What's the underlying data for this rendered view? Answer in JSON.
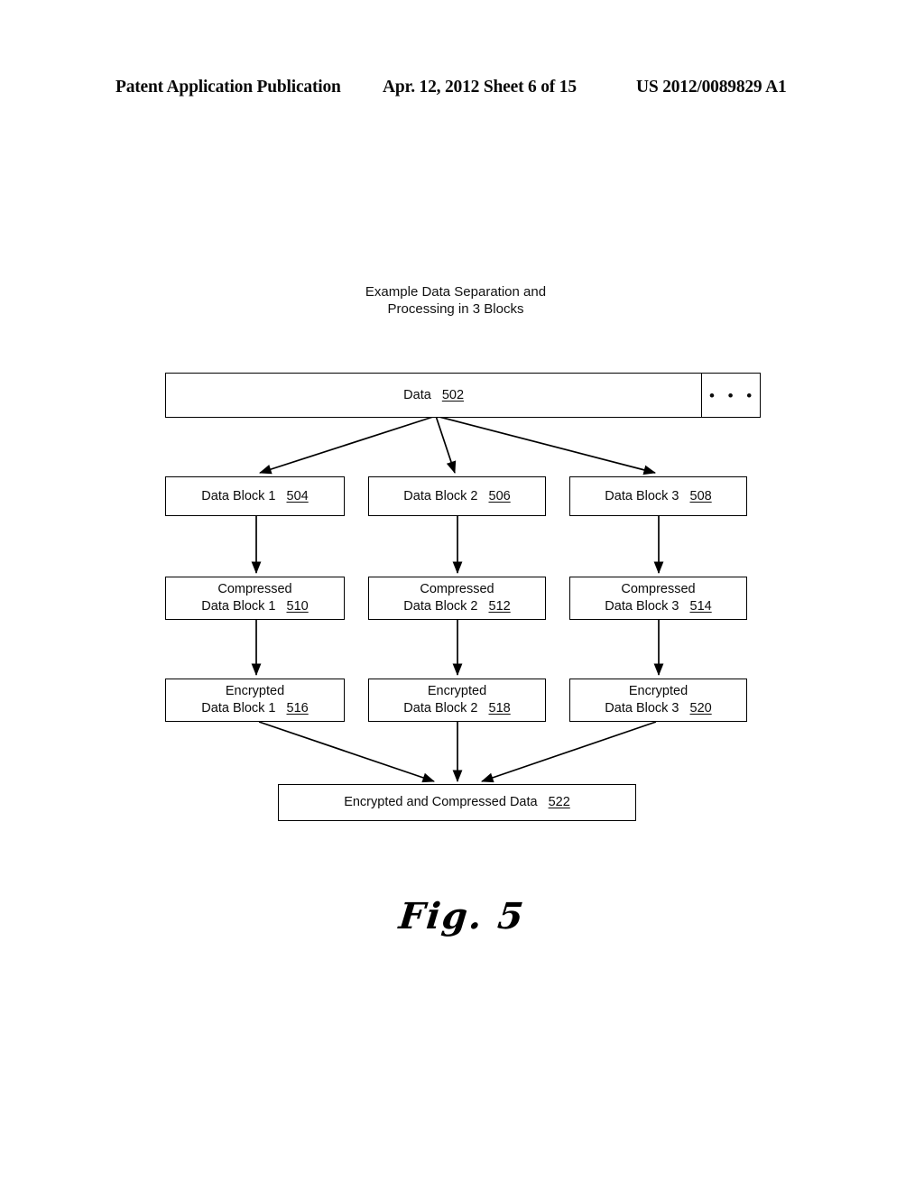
{
  "header": {
    "publication": "Patent Application Publication",
    "date_sheet": "Apr. 12, 2012  Sheet 6 of 15",
    "patent_number": "US 2012/0089829 A1"
  },
  "figure": {
    "title_line1": "Example Data Separation and",
    "title_line2": "Processing in 3 Blocks",
    "caption": "Fig. 5",
    "data_bar": {
      "label": "Data",
      "ref": "502",
      "ellipsis": "• • •"
    },
    "rows": {
      "data_blocks": [
        {
          "line1": "",
          "line2": "Data Block 1",
          "ref": "504"
        },
        {
          "line1": "",
          "line2": "Data Block 2",
          "ref": "506"
        },
        {
          "line1": "",
          "line2": "Data Block 3",
          "ref": "508"
        }
      ],
      "compressed_blocks": [
        {
          "line1": "Compressed",
          "line2": "Data Block 1",
          "ref": "510"
        },
        {
          "line1": "Compressed",
          "line2": "Data Block 2",
          "ref": "512"
        },
        {
          "line1": "Compressed",
          "line2": "Data Block 3",
          "ref": "514"
        }
      ],
      "encrypted_blocks": [
        {
          "line1": "Encrypted",
          "line2": "Data Block 1",
          "ref": "516"
        },
        {
          "line1": "Encrypted",
          "line2": "Data Block 2",
          "ref": "518"
        },
        {
          "line1": "Encrypted",
          "line2": "Data Block 3",
          "ref": "520"
        }
      ]
    },
    "final_block": {
      "label": "Encrypted and Compressed Data",
      "ref": "522"
    },
    "colors": {
      "line": "#000000",
      "page": "#ffffff",
      "text": "#000000"
    }
  }
}
